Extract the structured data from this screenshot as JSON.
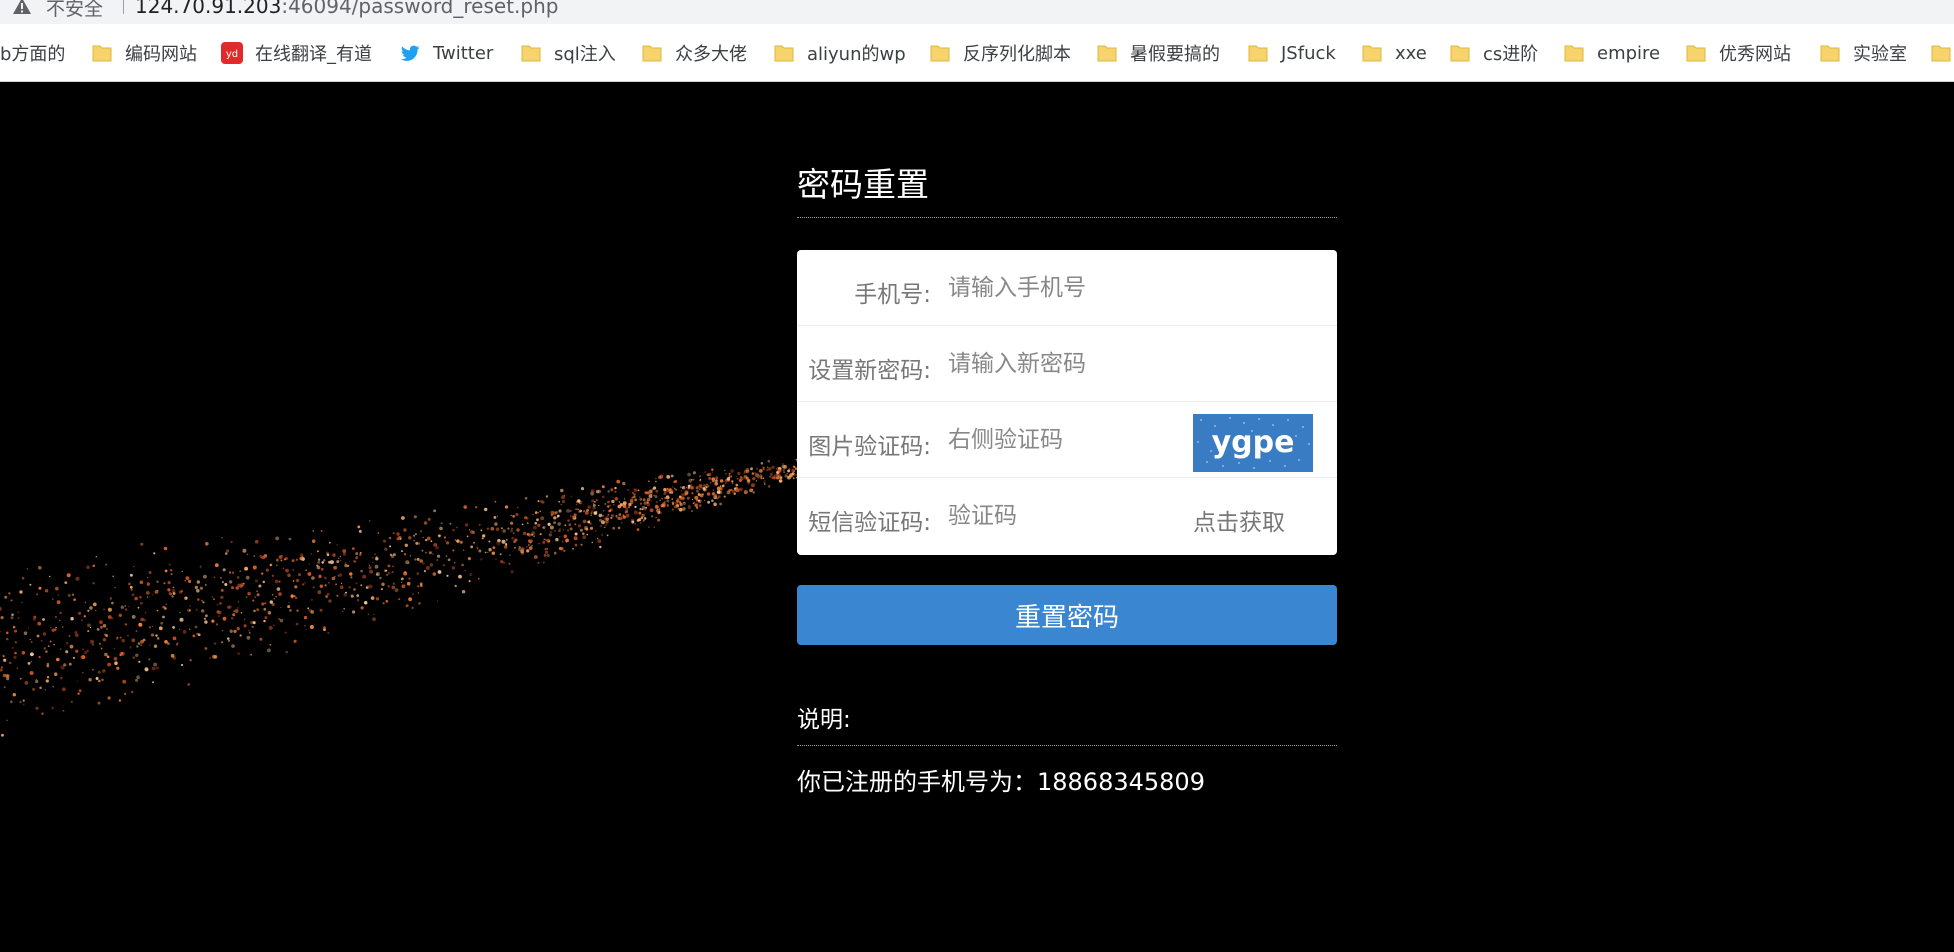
{
  "browser": {
    "security_label": "不安全",
    "url_host": "124.70.91.203",
    "url_path": ":46094/password_reset.php"
  },
  "bookmarks": [
    {
      "label": "b方面的",
      "icon": "none"
    },
    {
      "label": "编码网站",
      "icon": "folder-icon"
    },
    {
      "label": "在线翻译_有道",
      "icon": "youdao-icon"
    },
    {
      "label": "Twitter",
      "icon": "twitter-icon"
    },
    {
      "label": "sql注入",
      "icon": "folder-icon"
    },
    {
      "label": "众多大佬",
      "icon": "folder-icon"
    },
    {
      "label": "aliyun的wp",
      "icon": "folder-icon"
    },
    {
      "label": "反序列化脚本",
      "icon": "folder-icon"
    },
    {
      "label": "暑假要搞的",
      "icon": "folder-icon"
    },
    {
      "label": "JSfuck",
      "icon": "folder-icon"
    },
    {
      "label": "xxe",
      "icon": "folder-icon"
    },
    {
      "label": "cs进阶",
      "icon": "folder-icon"
    },
    {
      "label": "empire",
      "icon": "folder-icon"
    },
    {
      "label": "优秀网站",
      "icon": "folder-icon"
    },
    {
      "label": "实验室",
      "icon": "folder-icon"
    }
  ],
  "page": {
    "title": "密码重置",
    "form": {
      "phone_label": "手机号:",
      "phone_placeholder": "请输入手机号",
      "password_label": "设置新密码:",
      "password_placeholder": "请输入新密码",
      "captcha_label": "图片验证码:",
      "captcha_placeholder": "右侧验证码",
      "captcha_text": "ygpe",
      "sms_label": "短信验证码:",
      "sms_placeholder": "验证码",
      "sms_get_label": "点击获取"
    },
    "submit_label": "重置密码",
    "note_title": "说明:",
    "note_text": "你已注册的手机号为：18868345809"
  },
  "colors": {
    "accent": "#3a86d1",
    "background": "#000000",
    "folder": "#f7d36b"
  }
}
